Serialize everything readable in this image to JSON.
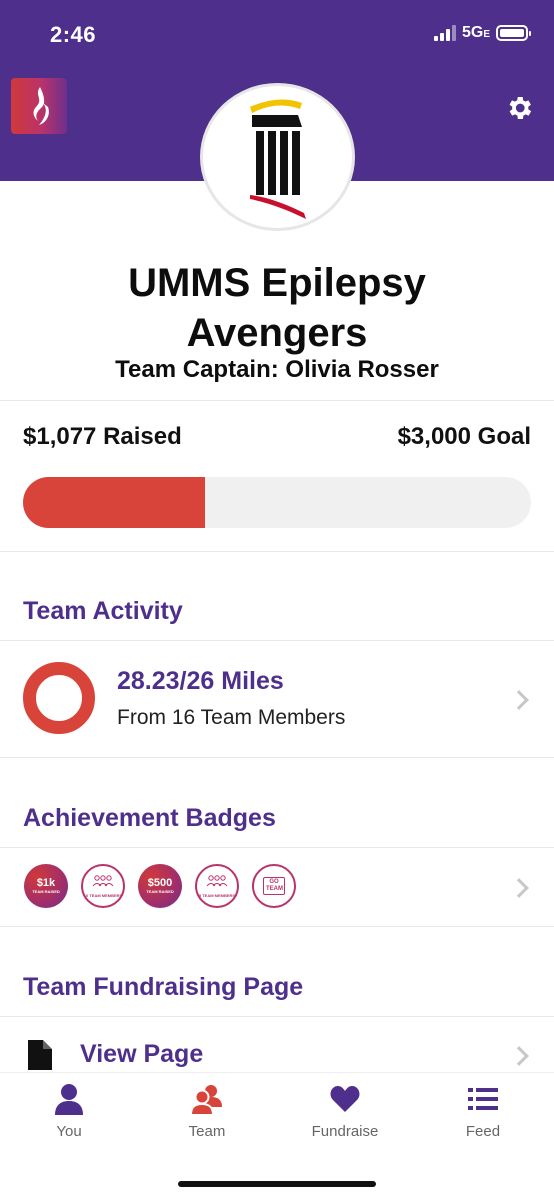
{
  "status_bar": {
    "time": "2:46",
    "network": "5G",
    "network_suffix": "E"
  },
  "header": {
    "app_logo_icon": "flame-icon",
    "settings_icon": "gear-icon",
    "team_logo_icon": "column-logo-icon"
  },
  "team": {
    "name": "UMMS Epilepsy Avengers",
    "captain": "Team Captain: Olivia Rosser"
  },
  "fundraising": {
    "raised_label": "$1,077 Raised",
    "goal_label": "$3,000 Goal",
    "progress_fraction": 0.359
  },
  "team_activity": {
    "title": "Team Activity",
    "miles": "28.23/26 Miles",
    "members": "From 16 Team Members"
  },
  "achievements": {
    "title": "Achievement Badges",
    "badges": [
      {
        "big": "$1k",
        "small": "TEAM RAISED",
        "style": "filled"
      },
      {
        "big": "",
        "small": "10 TEAM MEMBERS",
        "style": "outline"
      },
      {
        "big": "$500",
        "small": "TEAM RAISED",
        "style": "filled"
      },
      {
        "big": "",
        "small": "5 TEAM MEMBERS",
        "style": "outline"
      },
      {
        "big": "GO TEAM",
        "small": "",
        "style": "outline"
      }
    ]
  },
  "fundraising_page": {
    "title": "Team Fundraising Page",
    "link": "View Page"
  },
  "tabbar": {
    "tabs": [
      {
        "label": "You",
        "icon": "person-icon"
      },
      {
        "label": "Team",
        "icon": "team-icon"
      },
      {
        "label": "Fundraise",
        "icon": "heart-icon"
      },
      {
        "label": "Feed",
        "icon": "list-icon"
      }
    ]
  },
  "colors": {
    "brand_purple": "#4f2f8c",
    "accent_red": "#d9443a"
  }
}
